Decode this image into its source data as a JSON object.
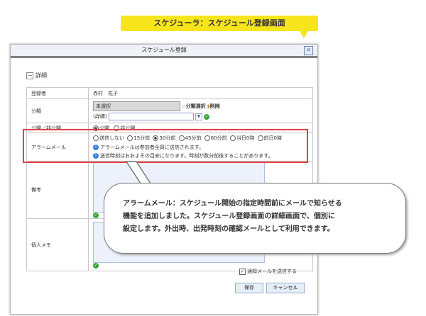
{
  "banner": {
    "title": "スケジューラ：スケジュール登録画面"
  },
  "window": {
    "title": "スケジュール登録",
    "close_symbol": "×"
  },
  "detail_toggle": {
    "symbol": "－",
    "label": "詳細"
  },
  "form": {
    "registrant": {
      "label": "登録者",
      "value": "赤村　花子"
    },
    "category": {
      "label": "分類",
      "selected": "未選択",
      "select_link": "分類選択",
      "delete_link": "削除",
      "detail_label": "(詳細)"
    },
    "visibility": {
      "label": "公開／非公開",
      "options": [
        "公開",
        "非公開"
      ],
      "selected_index": 0
    },
    "alarm": {
      "label": "アラームメール",
      "options": [
        "送信しない",
        "15分前",
        "30分前",
        "45分前",
        "60分前",
        "当日0時",
        "前日0時"
      ],
      "selected_index": 2,
      "note1": "アラームメールは参加者全員に送信されます。",
      "note2": "送信時刻はおおよその目安になります。時刻が数分前後することがあります。"
    },
    "remarks": {
      "label": "備考"
    },
    "personal_memo": {
      "label": "個人メモ"
    }
  },
  "callout": {
    "line1": "アラームメール：スケジュール開始の指定時間前にメールで知らせる",
    "line2": "機能を追加しました。スケジュール登録画面の詳細画面で、個別に",
    "line3": "設定します。外出時、出発時刻の確認メールとして利用できます。"
  },
  "footer": {
    "notify_label": "通知メールを送信する",
    "notify_checked": true,
    "save_label": "保存",
    "cancel_label": "キャンセル"
  }
}
